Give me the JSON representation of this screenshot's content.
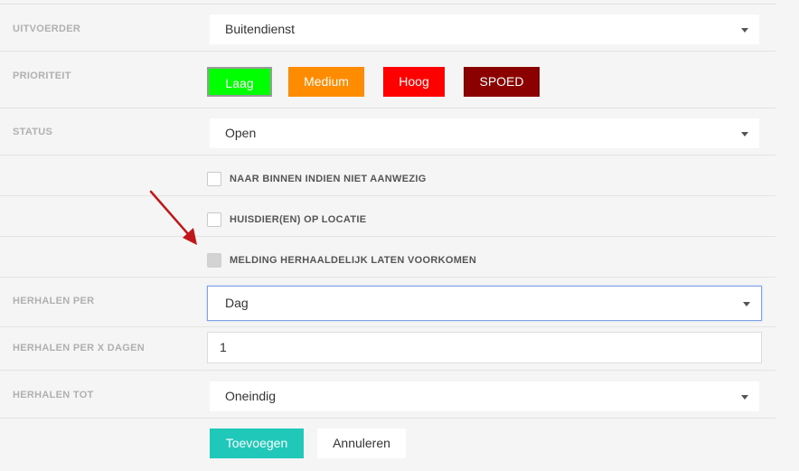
{
  "fields": {
    "uitvoerder": {
      "label": "UITVOERDER",
      "value": "Buitendienst"
    },
    "prioriteit": {
      "label": "PRIORITEIT",
      "options": [
        {
          "label": "Laag",
          "color": "#00ff00",
          "selected": true
        },
        {
          "label": "Medium",
          "color": "#ff8c00",
          "selected": false
        },
        {
          "label": "Hoog",
          "color": "#ff0000",
          "selected": false
        },
        {
          "label": "SPOED",
          "color": "#8b0000",
          "selected": false
        }
      ]
    },
    "status": {
      "label": "STATUS",
      "value": "Open"
    },
    "checkboxes": [
      {
        "label": "NAAR BINNEN INDIEN NIET AANWEZIG",
        "checked": false,
        "disabled": false
      },
      {
        "label": "HUISDIER(EN) OP LOCATIE",
        "checked": false,
        "disabled": false
      },
      {
        "label": "MELDING HERHAALDELIJK LATEN VOORKOMEN",
        "checked": false,
        "disabled": true
      }
    ],
    "herhalen_per": {
      "label": "HERHALEN PER",
      "value": "Dag"
    },
    "herhalen_per_x_dagen": {
      "label": "HERHALEN PER X DAGEN",
      "value": "1"
    },
    "herhalen_tot": {
      "label": "HERHALEN TOT",
      "value": "Oneindig"
    }
  },
  "actions": {
    "submit_label": "Toevoegen",
    "cancel_label": "Annuleren"
  },
  "colors": {
    "submit_bg": "#1fc8b8",
    "annotation_arrow": "#c0171b",
    "focus_border": "#7ea1e6"
  }
}
